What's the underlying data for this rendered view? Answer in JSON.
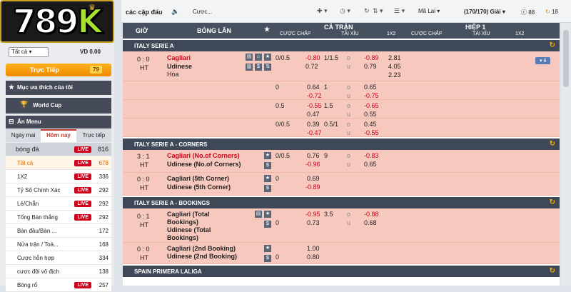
{
  "brand": {
    "logo_text": "789",
    "logo_k": "K"
  },
  "sidebar": {
    "filter_value": "Tất cả",
    "balance": "VD 0.00",
    "live": {
      "label": "Trực Tiếp",
      "count": "79"
    },
    "favorites": "Mục ưa thích của tôi",
    "world_cup": "World Cup",
    "hide_menu": "Ẩn Menu",
    "tabs": [
      "Ngày mai",
      "Hôm nay",
      "Trực tiếp"
    ],
    "items": [
      {
        "label": "bóng đá",
        "live": "LIVE",
        "count": "816"
      },
      {
        "label": "Tất cả",
        "live": "LIVE",
        "count": "678"
      },
      {
        "label": "1X2",
        "live": "LIVE",
        "count": "336"
      },
      {
        "label": "Tỷ Số Chính Xác",
        "live": "LIVE",
        "count": "292"
      },
      {
        "label": "Lẻ/Chẵn",
        "live": "LIVE",
        "count": "292"
      },
      {
        "label": "Tổng Bàn thắng",
        "live": "LIVE",
        "count": "292"
      },
      {
        "label": "Bàn đầu/Bàn ...",
        "live": "",
        "count": "172"
      },
      {
        "label": "Nửa trận / Toà...",
        "live": "",
        "count": "168"
      },
      {
        "label": "Cược hỗn hợp",
        "live": "",
        "count": "334"
      },
      {
        "label": "cược đội vô địch",
        "live": "",
        "count": "138"
      },
      {
        "label": "Bóng rổ",
        "live": "LIVE",
        "count": "257"
      }
    ]
  },
  "topbar": {
    "title": "các cặp đấu",
    "search": "Cược...",
    "odds_type": "Mã Lai",
    "count": "(170/170)",
    "count_label": "Giải",
    "coins": "88",
    "refresh": "18"
  },
  "table": {
    "h_time": "GIỜ",
    "h_ball": "BÓNG LĂN",
    "h_ft": "CẢ TRẬN",
    "h_ht": "HIỆP 1",
    "sub": [
      "CƯỢC CHẤP",
      "TÀI XỈU",
      "1X2",
      "CƯỢC CHẤP",
      "TÀI XỈU",
      "1X2"
    ],
    "more": "8",
    "leagues": [
      {
        "name": "ITALY SERIE A"
      },
      {
        "name": "ITALY SERIE A - CORNERS"
      },
      {
        "name": "ITALY SERIE A - BOOKINGS"
      },
      {
        "name": "SPAIN PRIMERA LALIGA"
      }
    ],
    "m1": {
      "score": "0 : 0",
      "ht": "HT",
      "home": "Cagliari",
      "away": "Udinese",
      "draw": "Hòa",
      "lines": [
        {
          "hc": "0/0.5",
          "h1": "-0.80",
          "h2": "0.72",
          "ou": "1/1.5",
          "o1": "-0.89",
          "o2": "0.79",
          "x1": "2.81",
          "x2": "4.05",
          "x3": "2.23"
        },
        {
          "hc": "0",
          "h1": "0.64",
          "h2": "-0.72",
          "ou": "1",
          "o1": "0.65",
          "o2": "-0.75"
        },
        {
          "hc": "0.5",
          "h1": "-0.55",
          "h2": "0.47",
          "ou": "1.5",
          "o1": "-0.65",
          "o2": "0.55"
        },
        {
          "hc": "0/0.5",
          "h1": "0.39",
          "h2": "-0.47",
          "ou": "0.5/1",
          "o1": "0.45",
          "o2": "-0.55"
        }
      ]
    },
    "m2": {
      "score": "3 : 1",
      "ht": "HT",
      "home": "Cagliari (No.of Corners)",
      "away": "Udinese (No.of Corners)",
      "hc": "0/0.5",
      "h1": "0.76",
      "h2": "-0.96",
      "ou": "9",
      "o1": "-0.83",
      "o2": "0.65"
    },
    "m3": {
      "score": "0 : 0",
      "ht": "HT",
      "home": "Cagliari (5th Corner)",
      "away": "Udinese (5th Corner)",
      "hc": "0",
      "h1": "0.69",
      "h2": "-0.89"
    },
    "m4": {
      "score": "0 : 1",
      "ht": "HT",
      "home1": "Cagliari (Total",
      "home2": "Bookings)",
      "away1": "Udinese (Total",
      "away2": "Bookings)",
      "hc": "0",
      "h1": "-0.95",
      "h2": "0.73",
      "ou": "3.5",
      "o1": "-0.88",
      "o2": "0.68"
    },
    "m5": {
      "score": "0 : 0",
      "ht": "HT",
      "home": "Cagliari (2nd Booking)",
      "away": "Udinese (2nd Booking)",
      "hc": "0",
      "h1": "1.00",
      "h2": "0.80"
    }
  }
}
